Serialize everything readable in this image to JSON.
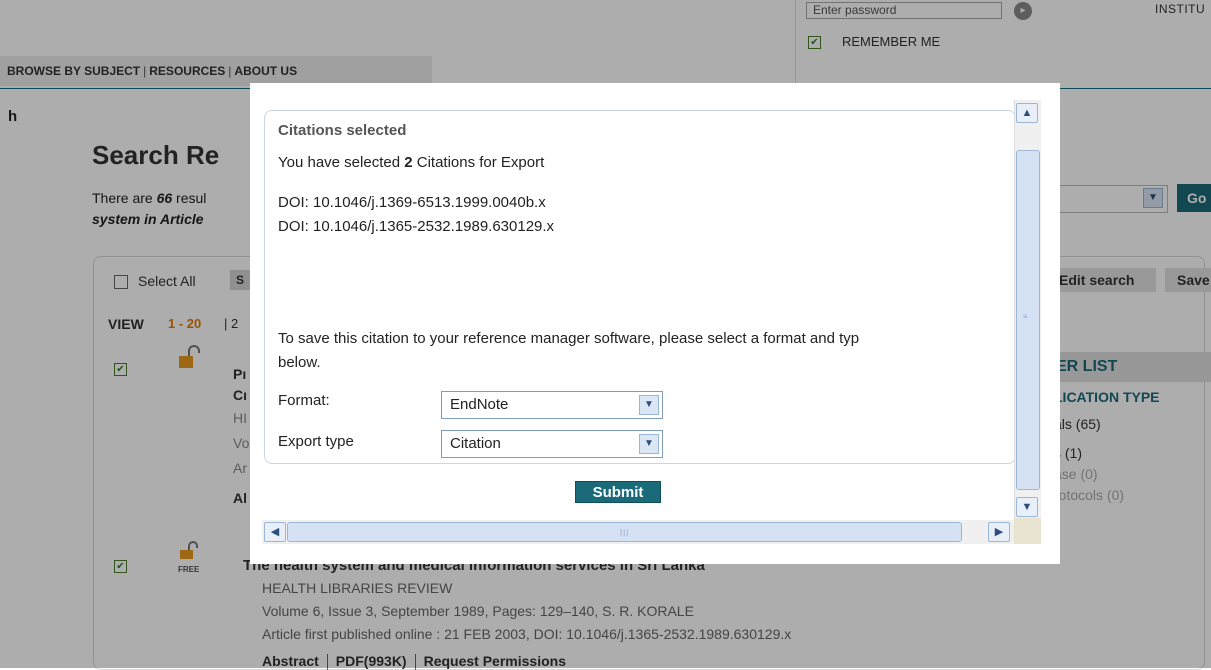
{
  "header": {
    "password_placeholder": "Enter password",
    "institution_label": "INSTITU",
    "remember_me_label": "REMEMBER ME",
    "nav_items": [
      "BROWSE BY SUBJECT",
      "RESOURCES",
      "ABOUT US"
    ]
  },
  "page": {
    "crumb": "h",
    "search_title": "Search Re",
    "results_prefix": "There are ",
    "results_count": "66",
    "results_suffix": " resul",
    "results_line2": "system in Article",
    "select_all_label": "Select All",
    "s_button_label": "S",
    "view_label": "VIEW",
    "view_range": "1 - 20",
    "view_sep": "|  2",
    "go_label": "Go",
    "edit_search_label": "Edit search",
    "save_label": "Save"
  },
  "filter": {
    "header": "ER LIST",
    "pub_type_label": "LICATION TYPE",
    "items": [
      "als (65)",
      "s (1)",
      "ase (0)",
      "rotocols (0)"
    ]
  },
  "results": [
    {
      "title_lines": [
        "Pı",
        "Cı"
      ],
      "lines": [
        "HI",
        "Vo",
        "Ar"
      ],
      "abstract_label": "Al"
    },
    {
      "title": "The health system and medical information services in Sri Lanka",
      "journal": "HEALTH LIBRARIES REVIEW",
      "volume": "Volume 6, Issue 3, September 1989, Pages: 129–140, S. R. KORALE",
      "published": "Article first published online : 21 FEB 2003, DOI: 10.1046/j.1365-2532.1989.630129.x",
      "links": [
        "Abstract",
        "PDF(993K)",
        "Request Permissions"
      ],
      "free_label": "FREE"
    }
  ],
  "modal": {
    "title": "Citations selected",
    "selected_prefix": "You have selected ",
    "selected_count": "2",
    "selected_suffix": " Citations for Export",
    "dois": [
      "DOI: 10.1046/j.1369-6513.1999.0040b.x",
      "DOI: 10.1046/j.1365-2532.1989.630129.x"
    ],
    "save_text_line1": "To save this citation to your reference manager software, please select a format and typ",
    "save_text_line2": "below.",
    "format_label": "Format:",
    "format_value": "EndNote",
    "export_type_label": "Export type",
    "export_type_value": "Citation",
    "submit_label": "Submit"
  },
  "colors": {
    "accent": "#1a6a7a",
    "range_orange": "#e87900"
  }
}
